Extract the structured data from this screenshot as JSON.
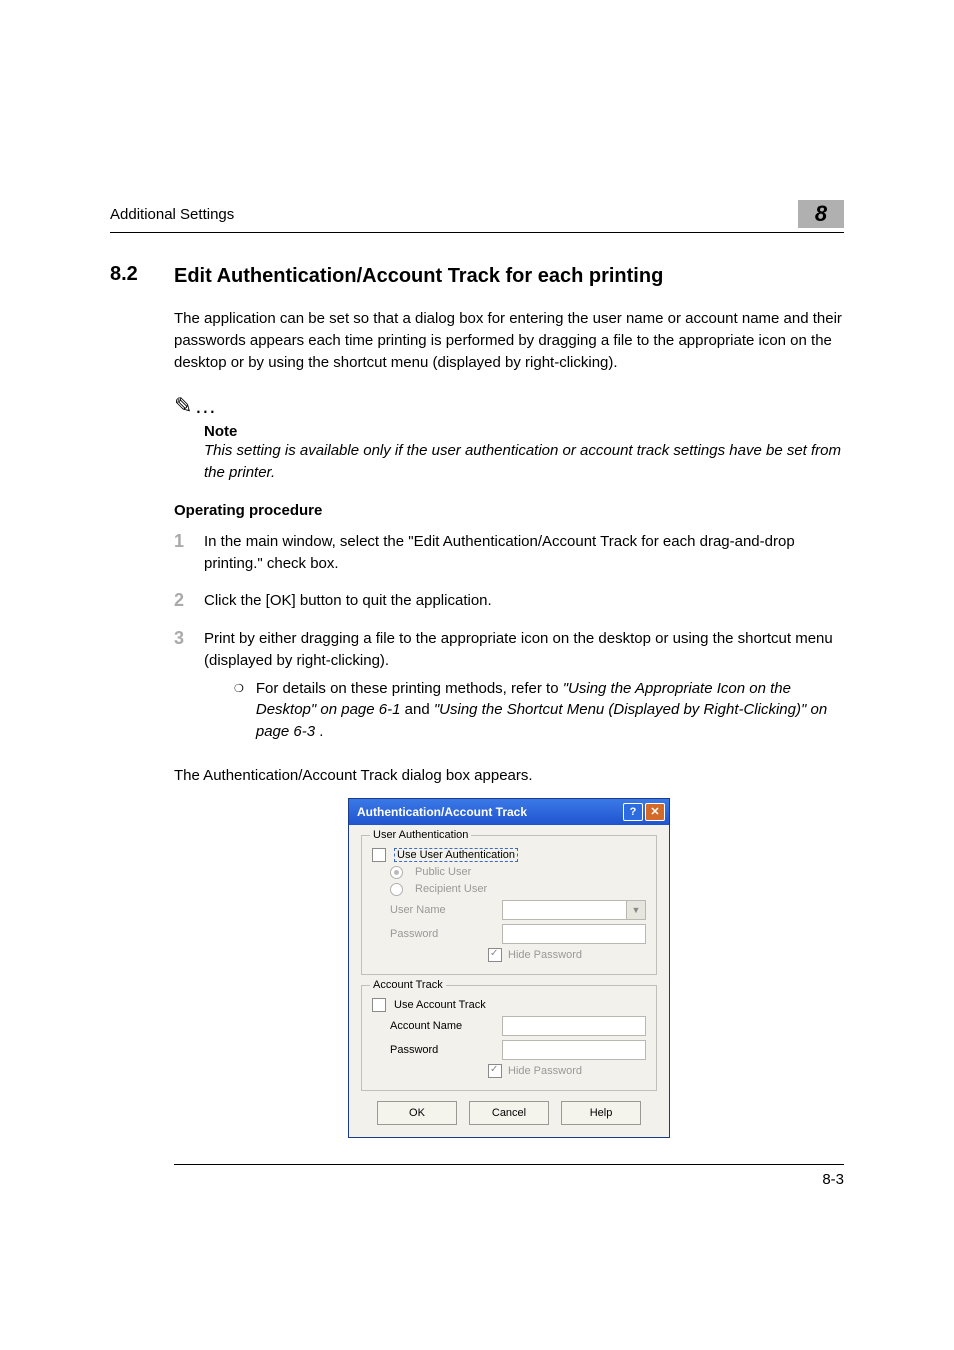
{
  "header": {
    "running": "Additional Settings",
    "chapter": "8"
  },
  "section": {
    "number": "8.2",
    "title": "Edit Authentication/Account Track for each printing"
  },
  "intro": "The application can be set so that a dialog box for entering the user name or account name and their passwords appears each time printing is performed by dragging a file to the appropriate icon on the desktop or by using the shortcut menu (displayed by right-clicking).",
  "note": {
    "icon": "✎…",
    "label": "Note",
    "body": "This setting is available only if the user authentication or account track settings have be set from the printer."
  },
  "procedure_heading": "Operating procedure",
  "steps": [
    {
      "n": "1",
      "text": "In the main window, select the \"Edit Authentication/Account Track for each drag-and-drop printing.\" check box."
    },
    {
      "n": "2",
      "text": "Click the [OK] button to quit the application."
    },
    {
      "n": "3",
      "text": "Print by either dragging a file to the appropriate icon on the desktop or using the shortcut menu (displayed by right-clicking)."
    }
  ],
  "sub_bullet": {
    "lead": "For details on these printing methods, refer to ",
    "ref1": "\"Using the Appropriate Icon on the Desktop\" on page 6-1",
    "mid": " and ",
    "ref2": "\"Using the Shortcut Menu (Displayed by Right-Clicking)\" on page 6-3",
    "tail": "."
  },
  "after_steps": "The Authentication/Account Track dialog box appears.",
  "dialog": {
    "title": "Authentication/Account Track",
    "group1": {
      "legend": "User Authentication",
      "use_label": "Use User Authentication",
      "public": "Public User",
      "recipient": "Recipient User",
      "username": "User Name",
      "password": "Password",
      "hide": "Hide Password"
    },
    "group2": {
      "legend": "Account Track",
      "use_label": "Use Account Track",
      "acctname": "Account Name",
      "password": "Password",
      "hide": "Hide Password"
    },
    "buttons": {
      "ok": "OK",
      "cancel": "Cancel",
      "help": "Help"
    }
  },
  "footer": {
    "page": "8-3"
  }
}
